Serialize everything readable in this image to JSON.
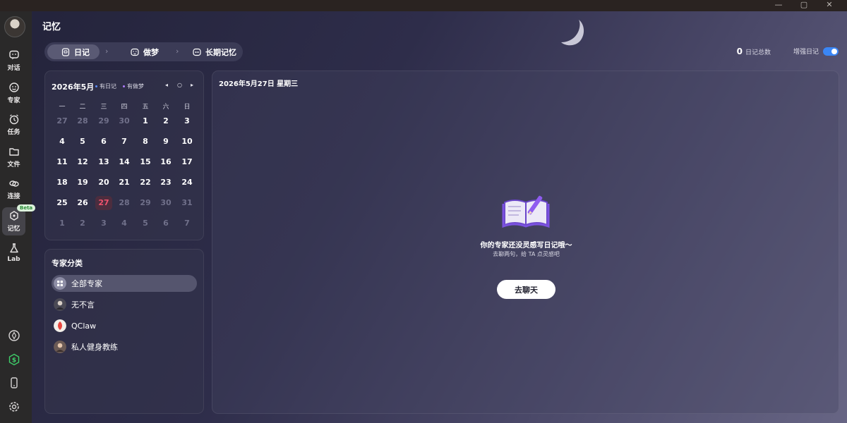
{
  "window": {
    "minimize": "—",
    "maximize": "▢",
    "close": "✕"
  },
  "sidebar": {
    "items": [
      {
        "label": "对话",
        "icon": "chat-icon"
      },
      {
        "label": "专家",
        "icon": "expert-face-icon"
      },
      {
        "label": "任务",
        "icon": "alarm-clock-icon"
      },
      {
        "label": "文件",
        "icon": "folder-icon"
      },
      {
        "label": "连接",
        "icon": "link-icon"
      },
      {
        "label": "记忆",
        "icon": "memory-icon",
        "badge": "Beta"
      },
      {
        "label": "Lab",
        "icon": "flask-icon"
      }
    ],
    "bottom_icons": [
      "compass-icon",
      "dollar-coin-icon",
      "phone-icon",
      "gear-icon"
    ]
  },
  "header": {
    "title": "记忆"
  },
  "tabs": [
    {
      "label": "日记",
      "icon": "diary-icon",
      "active": true
    },
    {
      "label": "做梦",
      "icon": "dream-face-icon",
      "active": false
    },
    {
      "label": "长期记忆",
      "icon": "long-memory-icon",
      "active": false
    }
  ],
  "tab_separator": "›",
  "stats": {
    "count": "0",
    "count_label": "日记总数",
    "enhance_label": "增强日记",
    "enhance_on": true
  },
  "calendar": {
    "title": "2026年5月",
    "legend": [
      {
        "label": "有日记",
        "color": "#5b8cff"
      },
      {
        "label": "有做梦",
        "color": "#b07cff"
      }
    ],
    "nav": {
      "prev": "◂",
      "today": "○",
      "next": "▸"
    },
    "weekdays": [
      "一",
      "二",
      "三",
      "四",
      "五",
      "六",
      "日"
    ],
    "weeks": [
      [
        {
          "d": "27",
          "m": 0
        },
        {
          "d": "28",
          "m": 0
        },
        {
          "d": "29",
          "m": 0
        },
        {
          "d": "30",
          "m": 0
        },
        {
          "d": "1",
          "m": 1
        },
        {
          "d": "2",
          "m": 1
        },
        {
          "d": "3",
          "m": 1
        }
      ],
      [
        {
          "d": "4",
          "m": 1
        },
        {
          "d": "5",
          "m": 1
        },
        {
          "d": "6",
          "m": 1
        },
        {
          "d": "7",
          "m": 1
        },
        {
          "d": "8",
          "m": 1
        },
        {
          "d": "9",
          "m": 1
        },
        {
          "d": "10",
          "m": 1
        }
      ],
      [
        {
          "d": "11",
          "m": 1
        },
        {
          "d": "12",
          "m": 1
        },
        {
          "d": "13",
          "m": 1
        },
        {
          "d": "14",
          "m": 1
        },
        {
          "d": "15",
          "m": 1
        },
        {
          "d": "16",
          "m": 1
        },
        {
          "d": "17",
          "m": 1
        }
      ],
      [
        {
          "d": "18",
          "m": 1
        },
        {
          "d": "19",
          "m": 1
        },
        {
          "d": "20",
          "m": 1
        },
        {
          "d": "21",
          "m": 1
        },
        {
          "d": "22",
          "m": 1
        },
        {
          "d": "23",
          "m": 1
        },
        {
          "d": "24",
          "m": 1
        }
      ],
      [
        {
          "d": "25",
          "m": 1
        },
        {
          "d": "26",
          "m": 1
        },
        {
          "d": "27",
          "m": 1,
          "today": true
        },
        {
          "d": "28",
          "m": 0
        },
        {
          "d": "29",
          "m": 0
        },
        {
          "d": "30",
          "m": 0
        },
        {
          "d": "31",
          "m": 0
        }
      ],
      [
        {
          "d": "1",
          "m": 0
        },
        {
          "d": "2",
          "m": 0
        },
        {
          "d": "3",
          "m": 0
        },
        {
          "d": "4",
          "m": 0
        },
        {
          "d": "5",
          "m": 0
        },
        {
          "d": "6",
          "m": 0
        },
        {
          "d": "7",
          "m": 0
        }
      ]
    ]
  },
  "experts": {
    "title": "专家分类",
    "items": [
      {
        "name": "全部专家",
        "avatar": "grid-icon",
        "color": "#9a9ab0",
        "active": true
      },
      {
        "name": "无不言",
        "avatar": "avatar-wubuyan",
        "color": "#4b4a55",
        "active": false
      },
      {
        "name": "QClaw",
        "avatar": "avatar-qclaw",
        "color": "#e8473f",
        "active": false
      },
      {
        "name": "私人健身教练",
        "avatar": "avatar-trainer",
        "color": "#6b5a55",
        "active": false
      }
    ]
  },
  "diary": {
    "date": "2026年5月27日 星期三",
    "empty_title": "你的专家还没灵感写日记哦～",
    "empty_sub": "去聊两句，给 TA 点灵感吧",
    "cta": "去聊天"
  }
}
